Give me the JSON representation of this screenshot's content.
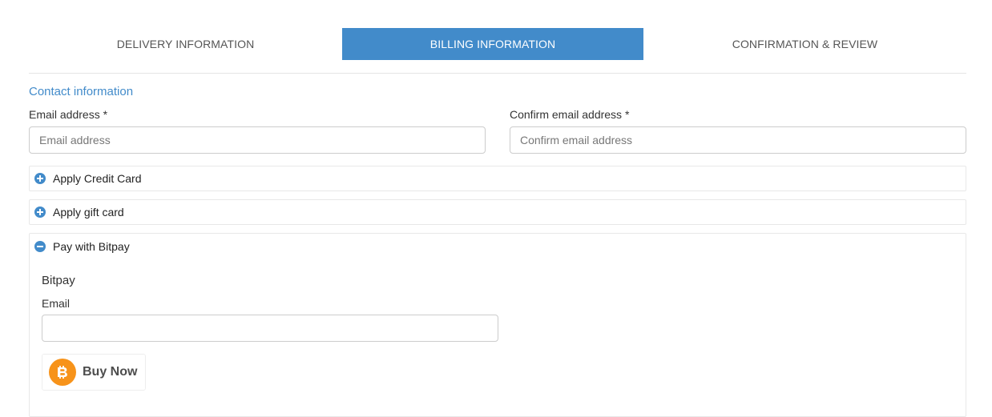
{
  "steps": [
    {
      "label": "DELIVERY INFORMATION",
      "active": false
    },
    {
      "label": "BILLING INFORMATION",
      "active": true
    },
    {
      "label": "CONFIRMATION & REVIEW",
      "active": false
    }
  ],
  "contact": {
    "title": "Contact information",
    "email_label": "Email address *",
    "email_placeholder": "Email address",
    "email_value": "",
    "confirm_label": "Confirm email address *",
    "confirm_placeholder": "Confirm email address",
    "confirm_value": ""
  },
  "panels": [
    {
      "label": "Apply Credit Card",
      "expanded": false,
      "icon": "plus-circle-icon"
    },
    {
      "label": "Apply gift card",
      "expanded": false,
      "icon": "plus-circle-icon"
    },
    {
      "label": "Pay with Bitpay",
      "expanded": true,
      "icon": "minus-circle-icon"
    }
  ],
  "bitpay": {
    "title": "Bitpay",
    "email_label": "Email",
    "email_value": "",
    "button_label": "Buy Now",
    "button_icon": "bitcoin-icon"
  },
  "colors": {
    "accent": "#428bca",
    "bitcoin": "#f7931a",
    "border": "#cccccc"
  }
}
